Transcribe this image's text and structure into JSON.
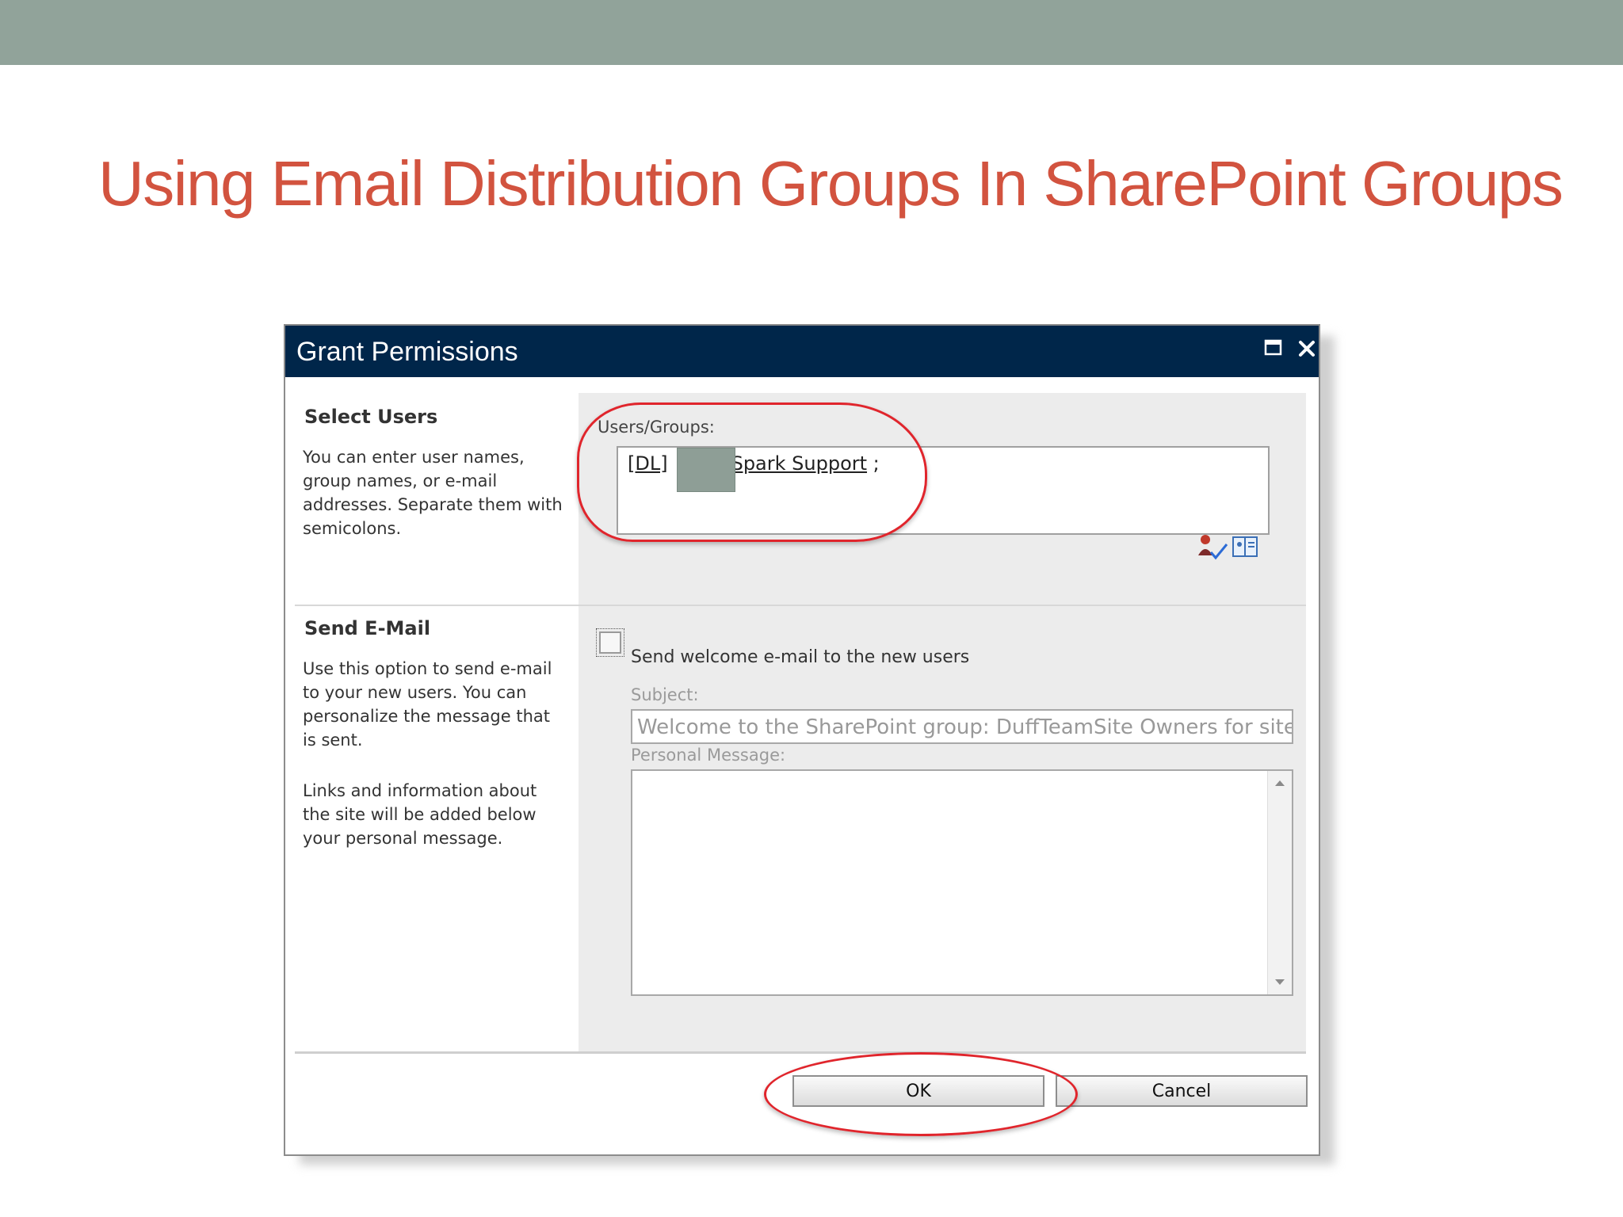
{
  "slide": {
    "title": "Using Email Distribution Groups In SharePoint Groups"
  },
  "dialog": {
    "title": "Grant Permissions",
    "maximize_icon": "maximize-icon",
    "close_icon": "close-icon",
    "select_users": {
      "heading": "Select Users",
      "description": "You can enter user names, group names, or e-mail addresses. Separate them with semicolons.",
      "field_label": "Users/Groups:",
      "entry_prefix": "[DL]",
      "entry_name": "Spark Support",
      "entry_suffix": ";",
      "check_names_icon": "check-names-icon",
      "browse_icon": "address-book-icon"
    },
    "send_email": {
      "heading": "Send E-Mail",
      "description_1": "Use this option to send e-mail to your new users. You can personalize the message that is sent.",
      "description_2": "Links and information about the site will be added below your personal message.",
      "checkbox_label": "Send welcome e-mail to the new users",
      "checkbox_checked": false,
      "subject_label": "Subject:",
      "subject_value": "Welcome to the SharePoint group: DuffTeamSite Owners for site: D",
      "message_label": "Personal Message:",
      "message_value": ""
    },
    "buttons": {
      "ok": "OK",
      "cancel": "Cancel"
    }
  },
  "colors": {
    "top_band": "#91a39a",
    "title_text": "#d2533f",
    "dialog_titlebar": "#00264a",
    "annotation": "#e0252c"
  }
}
